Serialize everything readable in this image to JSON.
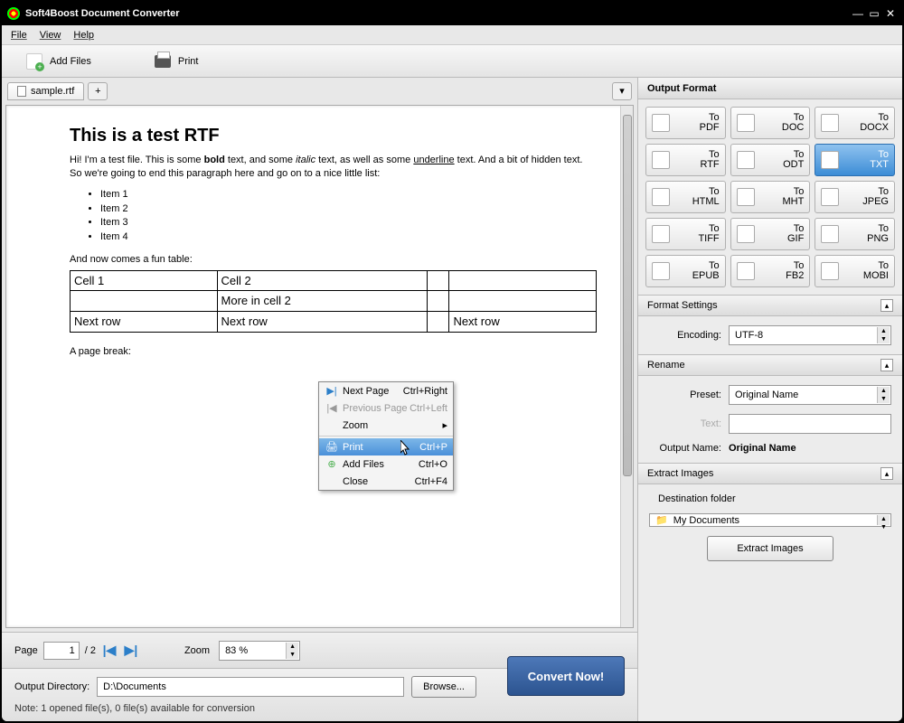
{
  "title": "Soft4Boost Document Converter",
  "menubar": [
    "File",
    "View",
    "Help"
  ],
  "toolbar": {
    "add": "Add Files",
    "print": "Print"
  },
  "tab": {
    "filename": "sample.rtf"
  },
  "doc": {
    "heading": "This is a test RTF",
    "p1a": "Hi! I'm a test file. This is some ",
    "p1b": "bold",
    "p1c": " text, and some ",
    "p1d": "italic",
    "p1e": " text, as well as some ",
    "p1f": "underline",
    "p1g": " text. And a bit of hidden text. So we're going to end this paragraph here and go on to a nice little list:",
    "items": [
      "Item 1",
      "Item 2",
      "Item 3",
      "Item 4"
    ],
    "tableintro": "And now comes a fun table:",
    "table": [
      [
        "Cell 1",
        "Cell 2",
        "",
        ""
      ],
      [
        "",
        "More in cell 2",
        "",
        ""
      ],
      [
        "Next row",
        "Next row",
        "",
        "Next row"
      ]
    ],
    "break": "A page break:"
  },
  "ctx": {
    "next": {
      "label": "Next Page",
      "sc": "Ctrl+Right"
    },
    "prev": {
      "label": "Previous Page",
      "sc": "Ctrl+Left"
    },
    "zoom": {
      "label": "Zoom"
    },
    "print": {
      "label": "Print",
      "sc": "Ctrl+P"
    },
    "add": {
      "label": "Add Files",
      "sc": "Ctrl+O"
    },
    "close": {
      "label": "Close",
      "sc": "Ctrl+F4"
    }
  },
  "pager": {
    "label": "Page",
    "current": "1",
    "total": "/ 2",
    "zoomlabel": "Zoom",
    "zoom": "83 %"
  },
  "output": {
    "label": "Output Directory:",
    "value": "D:\\Documents",
    "browse": "Browse...",
    "convert": "Convert Now!",
    "note": "Note: 1 opened file(s), 0 file(s) available for conversion"
  },
  "right": {
    "hdr": "Output Format",
    "formats": [
      {
        "to": "To",
        "ext": "PDF"
      },
      {
        "to": "To",
        "ext": "DOC"
      },
      {
        "to": "To",
        "ext": "DOCX"
      },
      {
        "to": "To",
        "ext": "RTF"
      },
      {
        "to": "To",
        "ext": "ODT"
      },
      {
        "to": "To",
        "ext": "TXT",
        "sel": true
      },
      {
        "to": "To",
        "ext": "HTML"
      },
      {
        "to": "To",
        "ext": "MHT"
      },
      {
        "to": "To",
        "ext": "JPEG"
      },
      {
        "to": "To",
        "ext": "TIFF"
      },
      {
        "to": "To",
        "ext": "GIF"
      },
      {
        "to": "To",
        "ext": "PNG"
      },
      {
        "to": "To",
        "ext": "EPUB"
      },
      {
        "to": "To",
        "ext": "FB2"
      },
      {
        "to": "To",
        "ext": "MOBI"
      }
    ],
    "fs": {
      "hdr": "Format Settings",
      "enc_label": "Encoding:",
      "enc_value": "UTF-8"
    },
    "rn": {
      "hdr": "Rename",
      "preset_label": "Preset:",
      "preset_value": "Original Name",
      "text_label": "Text:",
      "out_label": "Output Name:",
      "out_value": "Original Name"
    },
    "ei": {
      "hdr": "Extract Images",
      "dest_label": "Destination folder",
      "dest_value": "My Documents",
      "btn": "Extract Images"
    }
  }
}
